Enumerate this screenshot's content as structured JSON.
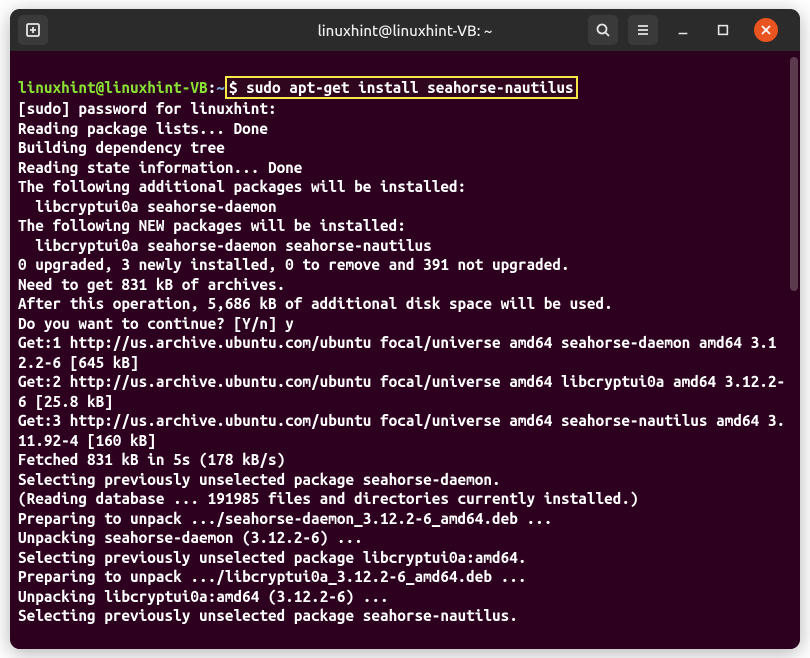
{
  "titlebar": {
    "title": "linuxhint@linuxhint-VB: ~",
    "new_tab_icon": "new-tab",
    "search_icon": "search",
    "menu_icon": "hamburger",
    "minimize_icon": "minimize",
    "maximize_icon": "maximize",
    "close_icon": "close"
  },
  "terminal": {
    "prompt_user_host": "linuxhint@linuxhint-VB",
    "prompt_colon": ":",
    "prompt_path": "$ ",
    "highlighted_command": "$ sudo apt-get install seahorse-nautilus",
    "lines": [
      "[sudo] password for linuxhint:",
      "Reading package lists... Done",
      "Building dependency tree",
      "Reading state information... Done",
      "The following additional packages will be installed:",
      "  libcryptui0a seahorse-daemon",
      "The following NEW packages will be installed:",
      "  libcryptui0a seahorse-daemon seahorse-nautilus",
      "0 upgraded, 3 newly installed, 0 to remove and 391 not upgraded.",
      "Need to get 831 kB of archives.",
      "After this operation, 5,686 kB of additional disk space will be used.",
      "Do you want to continue? [Y/n] y",
      "Get:1 http://us.archive.ubuntu.com/ubuntu focal/universe amd64 seahorse-daemon amd64 3.12.2-6 [645 kB]",
      "Get:2 http://us.archive.ubuntu.com/ubuntu focal/universe amd64 libcryptui0a amd64 3.12.2-6 [25.8 kB]",
      "Get:3 http://us.archive.ubuntu.com/ubuntu focal/universe amd64 seahorse-nautilus amd64 3.11.92-4 [160 kB]",
      "Fetched 831 kB in 5s (178 kB/s)",
      "Selecting previously unselected package seahorse-daemon.",
      "(Reading database ... 191985 files and directories currently installed.)",
      "Preparing to unpack .../seahorse-daemon_3.12.2-6_amd64.deb ...",
      "Unpacking seahorse-daemon (3.12.2-6) ...",
      "Selecting previously unselected package libcryptui0a:amd64.",
      "Preparing to unpack .../libcryptui0a_3.12.2-6_amd64.deb ...",
      "Unpacking libcryptui0a:amd64 (3.12.2-6) ...",
      "Selecting previously unselected package seahorse-nautilus."
    ]
  }
}
